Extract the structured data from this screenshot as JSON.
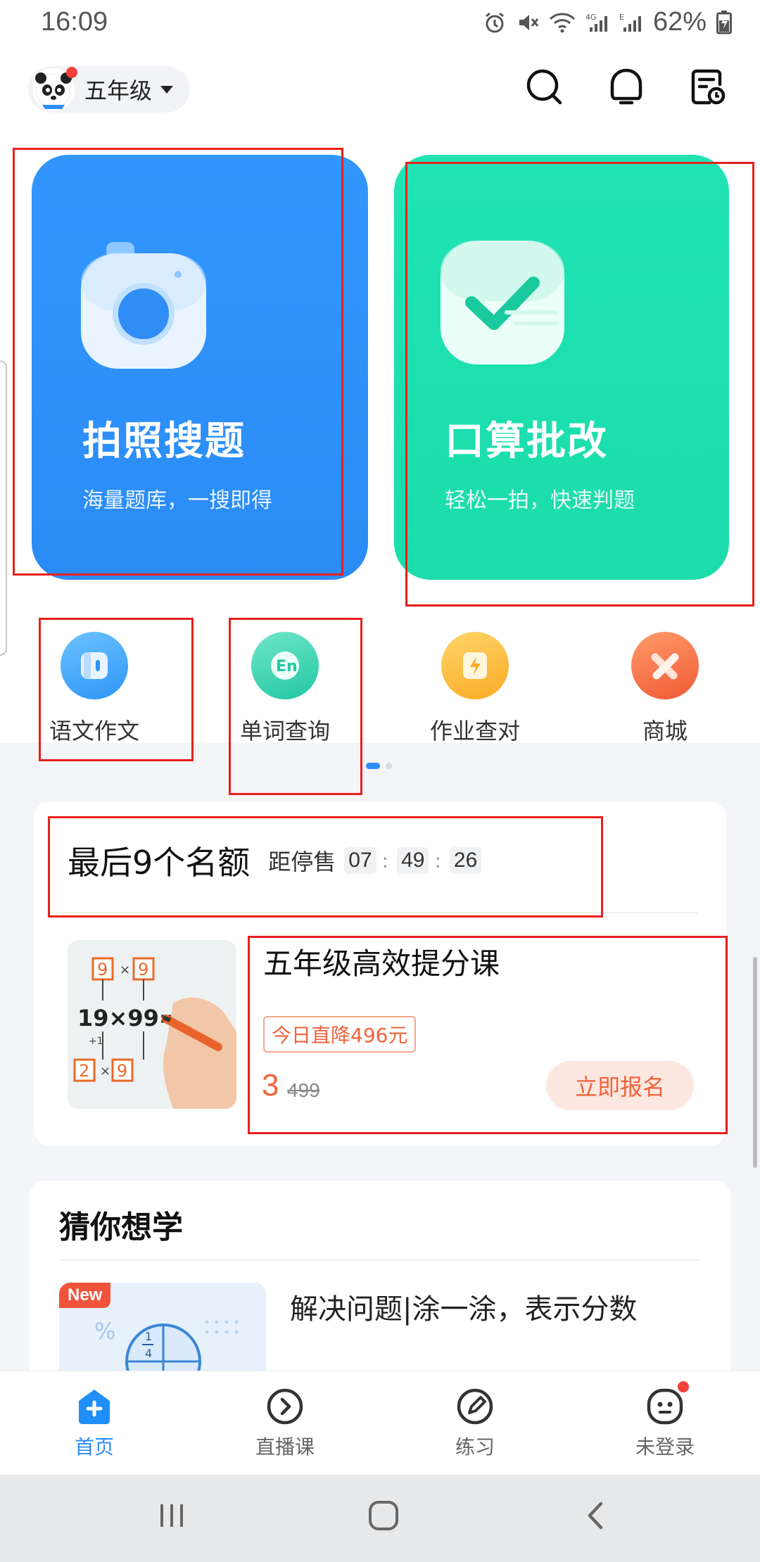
{
  "status_bar": {
    "time": "16:09",
    "battery": "62%"
  },
  "header": {
    "grade": "五年级"
  },
  "cards": {
    "photo_search": {
      "title": "拍照搜题",
      "subtitle": "海量题库，一搜即得",
      "color": "#2b8bf5"
    },
    "oral_correct": {
      "title": "口算批改",
      "subtitle": "轻松一拍，快速判题",
      "color": "#1bdcaa"
    }
  },
  "shortcuts": [
    {
      "label": "语文作文",
      "icon": "notebook-icon",
      "color": "#3aa4f8"
    },
    {
      "label": "单词查询",
      "icon": "english-word-icon",
      "color": "#2fd4b0"
    },
    {
      "label": "作业查对",
      "icon": "lightning-check-icon",
      "color": "#fbb93a"
    },
    {
      "label": "商城",
      "icon": "mall-icon",
      "color": "#f5703f"
    }
  ],
  "promo": {
    "headline": "最后9个名额",
    "countdown_label": "距停售",
    "countdown": {
      "h": "07",
      "m": "49",
      "s": "26"
    },
    "course_title": "五年级高效提分课",
    "discount": "今日直降496元",
    "price": "3",
    "old_price": "499",
    "signup": "立即报名",
    "thumb_text": {
      "a": "9",
      "b": "9",
      "equation": "19×99=",
      "c": "2",
      "d": "9",
      "small": "+1"
    }
  },
  "recommend": {
    "title": "猜你想学",
    "new_badge": "New",
    "lesson": "解决问题|涂一涂，表示分数",
    "thumb_fraction_top": "1",
    "thumb_fraction_bottom": "4",
    "thumb_percent": "%"
  },
  "bottom_nav": [
    {
      "label": "首页",
      "icon": "home-icon",
      "active": true
    },
    {
      "label": "直播课",
      "icon": "live-class-icon",
      "active": false
    },
    {
      "label": "练习",
      "icon": "practice-icon",
      "active": false
    },
    {
      "label": "未登录",
      "icon": "profile-icon",
      "active": false
    }
  ]
}
